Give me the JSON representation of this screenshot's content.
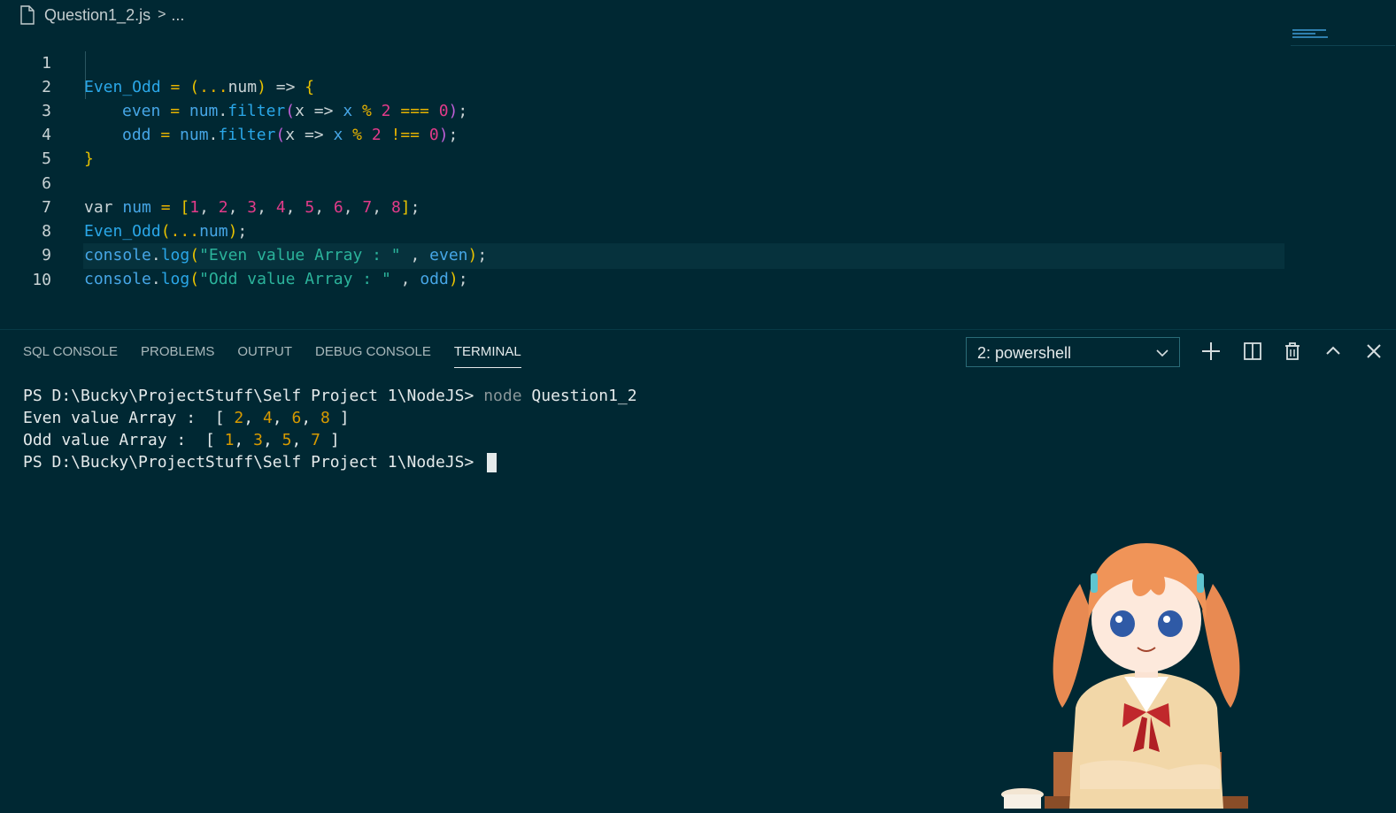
{
  "breadcrumb": {
    "filename": "Question1_2.js",
    "separator": ">",
    "rest": "..."
  },
  "editor": {
    "line_numbers": [
      "1",
      "2",
      "3",
      "4",
      "5",
      "6",
      "7",
      "8",
      "9",
      "10"
    ],
    "line1": {
      "a": "Even_Odd",
      "b": " = ",
      "c": "(",
      "d": "...",
      "e": "num",
      "f": ")",
      "g": " => ",
      "h": "{"
    },
    "line2": {
      "a": "even",
      "b": " = ",
      "c": "num",
      "d": ".",
      "e": "filter",
      "f": "(",
      "g": "x",
      "h": " => ",
      "i": "x",
      "j": " % ",
      "k": "2",
      "l": " === ",
      "m": "0",
      "n": ")",
      "o": ";"
    },
    "line3": {
      "a": "odd",
      "b": " = ",
      "c": "num",
      "d": ".",
      "e": "filter",
      "f": "(",
      "g": "x",
      "h": " => ",
      "i": "x",
      "j": " % ",
      "k": "2",
      "l": " !== ",
      "m": "0",
      "n": ")",
      "o": ";"
    },
    "line4": {
      "a": "}"
    },
    "line6": {
      "kw": "var",
      "a": " num",
      "b": " = ",
      "c": "[",
      "n1": "1",
      "n2": "2",
      "n3": "3",
      "n4": "4",
      "n5": "5",
      "n6": "6",
      "n7": "7",
      "n8": "8",
      "comma": ", ",
      "d": "]",
      "e": ";"
    },
    "line7": {
      "a": "Even_Odd",
      "b": "(",
      "c": "...",
      "d": "num",
      "e": ")",
      "f": ";"
    },
    "line8": {
      "a": "console",
      "b": ".",
      "c": "log",
      "d": "(",
      "e": "\"Even value Array : \"",
      "f": " , ",
      "g": "even",
      "h": ")",
      "i": ";"
    },
    "line9": {
      "a": "console",
      "b": ".",
      "c": "log",
      "d": "(",
      "e": "\"Odd value Array : \"",
      "f": " , ",
      "g": "odd",
      "h": ")",
      "i": ";"
    }
  },
  "panel": {
    "tabs": [
      "SQL CONSOLE",
      "PROBLEMS",
      "OUTPUT",
      "DEBUG CONSOLE",
      "TERMINAL"
    ],
    "active_tab": "TERMINAL",
    "terminal_select": "2: powershell",
    "icons": [
      "plus-icon",
      "split-icon",
      "trash-icon",
      "chevron-up-icon",
      "close-icon"
    ]
  },
  "terminal": {
    "prompt": "PS D:\\Bucky\\ProjectStuff\\Self Project 1\\NodeJS>",
    "cmd_node": "node",
    "cmd_arg": "Question1_2",
    "even_label": "Even value Array :  [ ",
    "even_values": [
      "2",
      "4",
      "6",
      "8"
    ],
    "odd_label": "Odd value Array :  [ ",
    "odd_values": [
      "1",
      "3",
      "5",
      "7"
    ],
    "sep": ", ",
    "close": " ]"
  },
  "colors": {
    "background": "#002833",
    "number": "#e23b8a",
    "string": "#2bb39b",
    "identifier": "#2aa7e8",
    "bracket": "#e8c200"
  }
}
